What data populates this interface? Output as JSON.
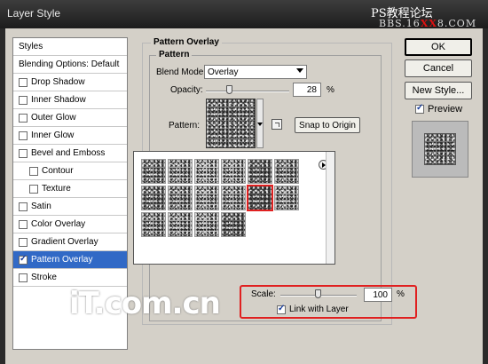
{
  "window": {
    "title": "Layer Style"
  },
  "watermark": {
    "line1": "PS教程论坛",
    "line2_prefix": "BBS.16",
    "line2_red": "XX",
    "line2_suffix": "8.COM"
  },
  "styles_panel": {
    "items": [
      {
        "label": "Styles",
        "checkbox": false,
        "checked": false,
        "indent": false,
        "active": false
      },
      {
        "label": "Blending Options: Default",
        "checkbox": false,
        "checked": false,
        "indent": false,
        "active": false
      },
      {
        "label": "Drop Shadow",
        "checkbox": true,
        "checked": false,
        "indent": false,
        "active": false
      },
      {
        "label": "Inner Shadow",
        "checkbox": true,
        "checked": false,
        "indent": false,
        "active": false
      },
      {
        "label": "Outer Glow",
        "checkbox": true,
        "checked": false,
        "indent": false,
        "active": false
      },
      {
        "label": "Inner Glow",
        "checkbox": true,
        "checked": false,
        "indent": false,
        "active": false
      },
      {
        "label": "Bevel and Emboss",
        "checkbox": true,
        "checked": false,
        "indent": false,
        "active": false
      },
      {
        "label": "Contour",
        "checkbox": true,
        "checked": false,
        "indent": true,
        "active": false
      },
      {
        "label": "Texture",
        "checkbox": true,
        "checked": false,
        "indent": true,
        "active": false
      },
      {
        "label": "Satin",
        "checkbox": true,
        "checked": false,
        "indent": false,
        "active": false
      },
      {
        "label": "Color Overlay",
        "checkbox": true,
        "checked": false,
        "indent": false,
        "active": false
      },
      {
        "label": "Gradient Overlay",
        "checkbox": true,
        "checked": false,
        "indent": false,
        "active": false
      },
      {
        "label": "Pattern Overlay",
        "checkbox": true,
        "checked": true,
        "indent": false,
        "active": true
      },
      {
        "label": "Stroke",
        "checkbox": true,
        "checked": false,
        "indent": false,
        "active": false
      }
    ]
  },
  "pattern_overlay": {
    "section_title": "Pattern Overlay",
    "group_title": "Pattern",
    "blend_mode_label": "Blend Mode:",
    "blend_mode_value": "Overlay",
    "opacity_label": "Opacity:",
    "opacity_value": "28",
    "opacity_unit": "%",
    "opacity_fraction": 0.28,
    "pattern_label": "Pattern:",
    "snap_button": "Snap to Origin",
    "scale_label": "Scale:",
    "scale_value": "100",
    "scale_unit": "%",
    "link_label": "Link with Layer",
    "link_checked": true
  },
  "pattern_picker": {
    "swatch_count": 16,
    "selected_index": 10
  },
  "buttons": {
    "ok": "OK",
    "cancel": "Cancel",
    "new_style": "New Style..."
  },
  "preview": {
    "label": "Preview",
    "checked": true
  },
  "logo": {
    "text": "iT.com.cn"
  },
  "colors": {
    "accent": "#3169c6",
    "highlight": "#e02020",
    "titlebar": "#2a2a2a"
  }
}
